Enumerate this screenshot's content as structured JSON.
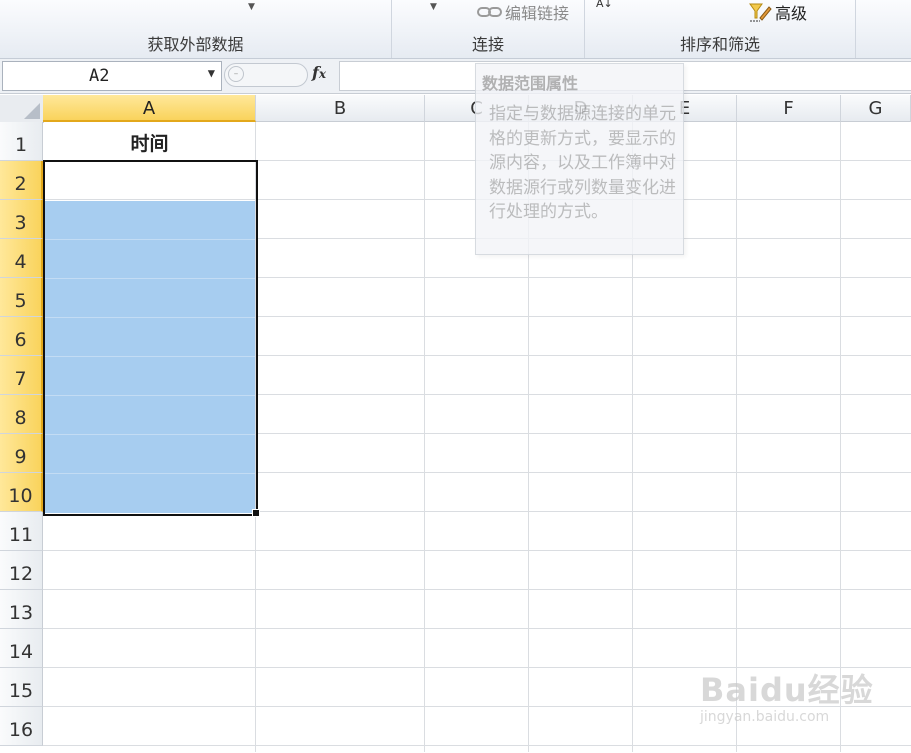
{
  "ribbon": {
    "groups": [
      {
        "label": "获取外部数据"
      },
      {
        "label": "连接"
      },
      {
        "label": "排序和筛选"
      }
    ],
    "edit_links": "编辑链接",
    "advanced": "高级",
    "sort_icon_text": "A↓"
  },
  "formula_bar": {
    "name_box": "A2",
    "fx": "fx",
    "formula": ""
  },
  "columns": [
    "A",
    "B",
    "C",
    "D",
    "E",
    "F",
    "G"
  ],
  "rows": [
    "1",
    "2",
    "3",
    "4",
    "5",
    "6",
    "7",
    "8",
    "9",
    "10",
    "11",
    "12",
    "13",
    "14",
    "15",
    "16"
  ],
  "cells": {
    "A1": "时间"
  },
  "selection": {
    "active_cell": "A2",
    "range": "A2:A10"
  },
  "tooltip": {
    "title": "数据范围属性",
    "body": "指定与数据源连接的单元格的更新方式，要显示的源内容，以及工作簿中对数据源行或列数量变化进行处理的方式。"
  },
  "watermark": {
    "brand": "Baidu经验",
    "url": "jingyan.baidu.com"
  },
  "colors": {
    "selection_fill": "#a7cdf0",
    "header_selected": "#f9d35c"
  }
}
